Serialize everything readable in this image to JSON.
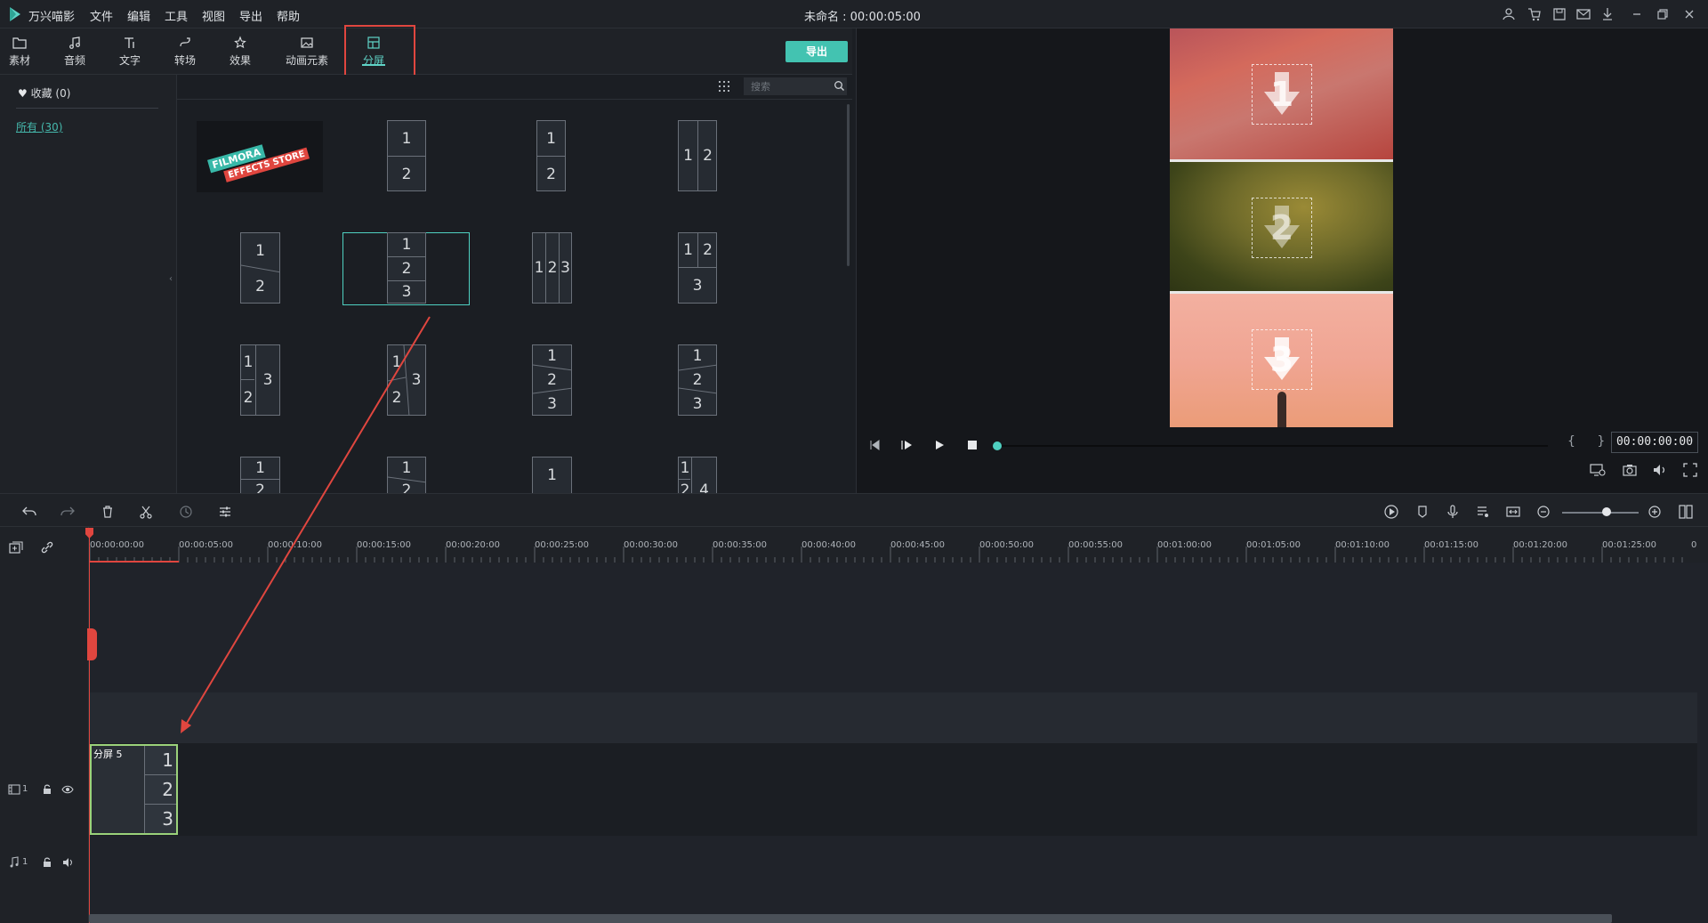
{
  "app": {
    "name": "万兴喵影",
    "document_title": "未命名 : 00:00:05:00",
    "menu": [
      "文件",
      "编辑",
      "工具",
      "视图",
      "导出",
      "帮助"
    ],
    "window_controls": [
      "user-icon",
      "cart-icon",
      "save-icon",
      "mail-icon",
      "download-icon",
      "minimize-icon",
      "restore-icon",
      "close-icon"
    ]
  },
  "toolbar": {
    "tabs": [
      {
        "label": "素材",
        "icon": "folder-icon"
      },
      {
        "label": "音频",
        "icon": "music-note-icon"
      },
      {
        "label": "文字",
        "icon": "text-icon"
      },
      {
        "label": "转场",
        "icon": "transition-icon"
      },
      {
        "label": "效果",
        "icon": "effects-icon"
      },
      {
        "label": "动画元素",
        "icon": "image-icon"
      },
      {
        "label": "分屏",
        "icon": "split-screen-icon"
      }
    ],
    "active_tab": "分屏",
    "export_label": "导出"
  },
  "categories": {
    "favorites": "收藏 (0)",
    "all": "所有 (30)"
  },
  "search": {
    "placeholder": "搜索"
  },
  "thumbnails": {
    "store_tile": {
      "line1": "FILMORA",
      "line2": "EFFECTS STORE"
    },
    "selected_index": 5
  },
  "preview": {
    "drop_numbers": [
      "1",
      "2",
      "3"
    ],
    "timecode": "00:00:00:00",
    "markers": "{ }",
    "progress": 0
  },
  "timeline": {
    "ruler_labels": [
      "00:00:00:00",
      "00:00:05:00",
      "00:00:10:00",
      "00:00:15:00",
      "00:00:20:00",
      "00:00:25:00",
      "00:00:30:00",
      "00:00:35:00",
      "00:00:40:00",
      "00:00:45:00",
      "00:00:50:00",
      "00:00:55:00",
      "00:01:00:00",
      "00:01:05:00",
      "00:01:10:00",
      "00:01:15:00",
      "00:01:20:00",
      "00:01:25:00",
      "0"
    ],
    "clip": {
      "label": "分屏 5",
      "cells": [
        "1",
        "2",
        "3"
      ]
    },
    "video_track_num": "1",
    "audio_track_num": "1"
  },
  "colors": {
    "accent": "#4fd0c1",
    "export_button": "#43c3b1",
    "highlight": "#e0463f",
    "clip_border": "#9bd27a"
  }
}
